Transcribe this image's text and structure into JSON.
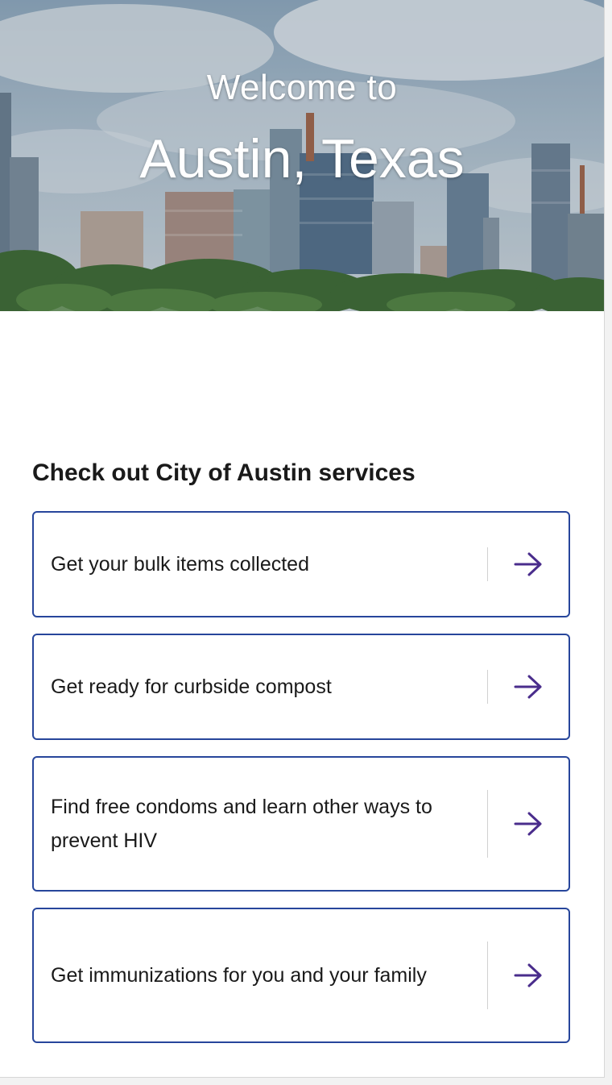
{
  "hero": {
    "welcome": "Welcome to",
    "city": "Austin, Texas"
  },
  "services": {
    "heading": "Check out City of Austin services",
    "items": [
      {
        "label": "Get your bulk items collected",
        "icon": "arrow-right-icon"
      },
      {
        "label": "Get ready for curbside compost",
        "icon": "arrow-right-icon"
      },
      {
        "label": "Find free condoms and learn other ways to prevent HIV",
        "icon": "arrow-right-icon"
      },
      {
        "label": "Get immunizations for you and your family",
        "icon": "arrow-right-icon"
      }
    ]
  },
  "colors": {
    "card_border": "#27469b",
    "arrow": "#4a2d8c",
    "text": "#1a1a1a"
  }
}
